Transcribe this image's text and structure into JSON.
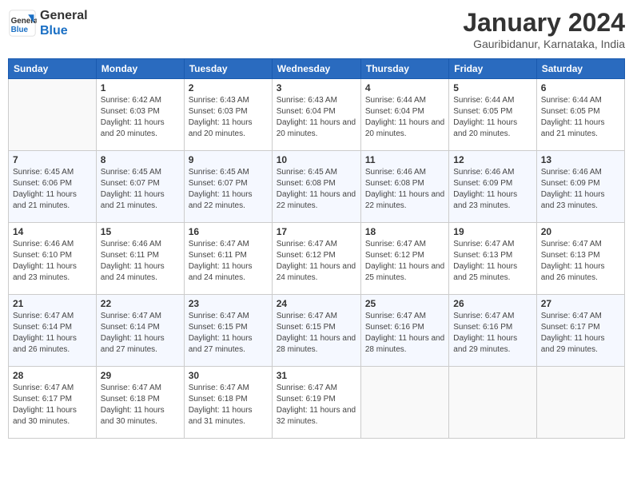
{
  "header": {
    "logo_line1": "General",
    "logo_line2": "Blue",
    "month_title": "January 2024",
    "subtitle": "Gauribidanur, Karnataka, India"
  },
  "days_of_week": [
    "Sunday",
    "Monday",
    "Tuesday",
    "Wednesday",
    "Thursday",
    "Friday",
    "Saturday"
  ],
  "weeks": [
    [
      {
        "day": "",
        "sunrise": "",
        "sunset": "",
        "daylight": ""
      },
      {
        "day": "1",
        "sunrise": "Sunrise: 6:42 AM",
        "sunset": "Sunset: 6:03 PM",
        "daylight": "Daylight: 11 hours and 20 minutes."
      },
      {
        "day": "2",
        "sunrise": "Sunrise: 6:43 AM",
        "sunset": "Sunset: 6:03 PM",
        "daylight": "Daylight: 11 hours and 20 minutes."
      },
      {
        "day": "3",
        "sunrise": "Sunrise: 6:43 AM",
        "sunset": "Sunset: 6:04 PM",
        "daylight": "Daylight: 11 hours and 20 minutes."
      },
      {
        "day": "4",
        "sunrise": "Sunrise: 6:44 AM",
        "sunset": "Sunset: 6:04 PM",
        "daylight": "Daylight: 11 hours and 20 minutes."
      },
      {
        "day": "5",
        "sunrise": "Sunrise: 6:44 AM",
        "sunset": "Sunset: 6:05 PM",
        "daylight": "Daylight: 11 hours and 20 minutes."
      },
      {
        "day": "6",
        "sunrise": "Sunrise: 6:44 AM",
        "sunset": "Sunset: 6:05 PM",
        "daylight": "Daylight: 11 hours and 21 minutes."
      }
    ],
    [
      {
        "day": "7",
        "sunrise": "Sunrise: 6:45 AM",
        "sunset": "Sunset: 6:06 PM",
        "daylight": "Daylight: 11 hours and 21 minutes."
      },
      {
        "day": "8",
        "sunrise": "Sunrise: 6:45 AM",
        "sunset": "Sunset: 6:07 PM",
        "daylight": "Daylight: 11 hours and 21 minutes."
      },
      {
        "day": "9",
        "sunrise": "Sunrise: 6:45 AM",
        "sunset": "Sunset: 6:07 PM",
        "daylight": "Daylight: 11 hours and 22 minutes."
      },
      {
        "day": "10",
        "sunrise": "Sunrise: 6:45 AM",
        "sunset": "Sunset: 6:08 PM",
        "daylight": "Daylight: 11 hours and 22 minutes."
      },
      {
        "day": "11",
        "sunrise": "Sunrise: 6:46 AM",
        "sunset": "Sunset: 6:08 PM",
        "daylight": "Daylight: 11 hours and 22 minutes."
      },
      {
        "day": "12",
        "sunrise": "Sunrise: 6:46 AM",
        "sunset": "Sunset: 6:09 PM",
        "daylight": "Daylight: 11 hours and 23 minutes."
      },
      {
        "day": "13",
        "sunrise": "Sunrise: 6:46 AM",
        "sunset": "Sunset: 6:09 PM",
        "daylight": "Daylight: 11 hours and 23 minutes."
      }
    ],
    [
      {
        "day": "14",
        "sunrise": "Sunrise: 6:46 AM",
        "sunset": "Sunset: 6:10 PM",
        "daylight": "Daylight: 11 hours and 23 minutes."
      },
      {
        "day": "15",
        "sunrise": "Sunrise: 6:46 AM",
        "sunset": "Sunset: 6:11 PM",
        "daylight": "Daylight: 11 hours and 24 minutes."
      },
      {
        "day": "16",
        "sunrise": "Sunrise: 6:47 AM",
        "sunset": "Sunset: 6:11 PM",
        "daylight": "Daylight: 11 hours and 24 minutes."
      },
      {
        "day": "17",
        "sunrise": "Sunrise: 6:47 AM",
        "sunset": "Sunset: 6:12 PM",
        "daylight": "Daylight: 11 hours and 24 minutes."
      },
      {
        "day": "18",
        "sunrise": "Sunrise: 6:47 AM",
        "sunset": "Sunset: 6:12 PM",
        "daylight": "Daylight: 11 hours and 25 minutes."
      },
      {
        "day": "19",
        "sunrise": "Sunrise: 6:47 AM",
        "sunset": "Sunset: 6:13 PM",
        "daylight": "Daylight: 11 hours and 25 minutes."
      },
      {
        "day": "20",
        "sunrise": "Sunrise: 6:47 AM",
        "sunset": "Sunset: 6:13 PM",
        "daylight": "Daylight: 11 hours and 26 minutes."
      }
    ],
    [
      {
        "day": "21",
        "sunrise": "Sunrise: 6:47 AM",
        "sunset": "Sunset: 6:14 PM",
        "daylight": "Daylight: 11 hours and 26 minutes."
      },
      {
        "day": "22",
        "sunrise": "Sunrise: 6:47 AM",
        "sunset": "Sunset: 6:14 PM",
        "daylight": "Daylight: 11 hours and 27 minutes."
      },
      {
        "day": "23",
        "sunrise": "Sunrise: 6:47 AM",
        "sunset": "Sunset: 6:15 PM",
        "daylight": "Daylight: 11 hours and 27 minutes."
      },
      {
        "day": "24",
        "sunrise": "Sunrise: 6:47 AM",
        "sunset": "Sunset: 6:15 PM",
        "daylight": "Daylight: 11 hours and 28 minutes."
      },
      {
        "day": "25",
        "sunrise": "Sunrise: 6:47 AM",
        "sunset": "Sunset: 6:16 PM",
        "daylight": "Daylight: 11 hours and 28 minutes."
      },
      {
        "day": "26",
        "sunrise": "Sunrise: 6:47 AM",
        "sunset": "Sunset: 6:16 PM",
        "daylight": "Daylight: 11 hours and 29 minutes."
      },
      {
        "day": "27",
        "sunrise": "Sunrise: 6:47 AM",
        "sunset": "Sunset: 6:17 PM",
        "daylight": "Daylight: 11 hours and 29 minutes."
      }
    ],
    [
      {
        "day": "28",
        "sunrise": "Sunrise: 6:47 AM",
        "sunset": "Sunset: 6:17 PM",
        "daylight": "Daylight: 11 hours and 30 minutes."
      },
      {
        "day": "29",
        "sunrise": "Sunrise: 6:47 AM",
        "sunset": "Sunset: 6:18 PM",
        "daylight": "Daylight: 11 hours and 30 minutes."
      },
      {
        "day": "30",
        "sunrise": "Sunrise: 6:47 AM",
        "sunset": "Sunset: 6:18 PM",
        "daylight": "Daylight: 11 hours and 31 minutes."
      },
      {
        "day": "31",
        "sunrise": "Sunrise: 6:47 AM",
        "sunset": "Sunset: 6:19 PM",
        "daylight": "Daylight: 11 hours and 32 minutes."
      },
      {
        "day": "",
        "sunrise": "",
        "sunset": "",
        "daylight": ""
      },
      {
        "day": "",
        "sunrise": "",
        "sunset": "",
        "daylight": ""
      },
      {
        "day": "",
        "sunrise": "",
        "sunset": "",
        "daylight": ""
      }
    ]
  ]
}
